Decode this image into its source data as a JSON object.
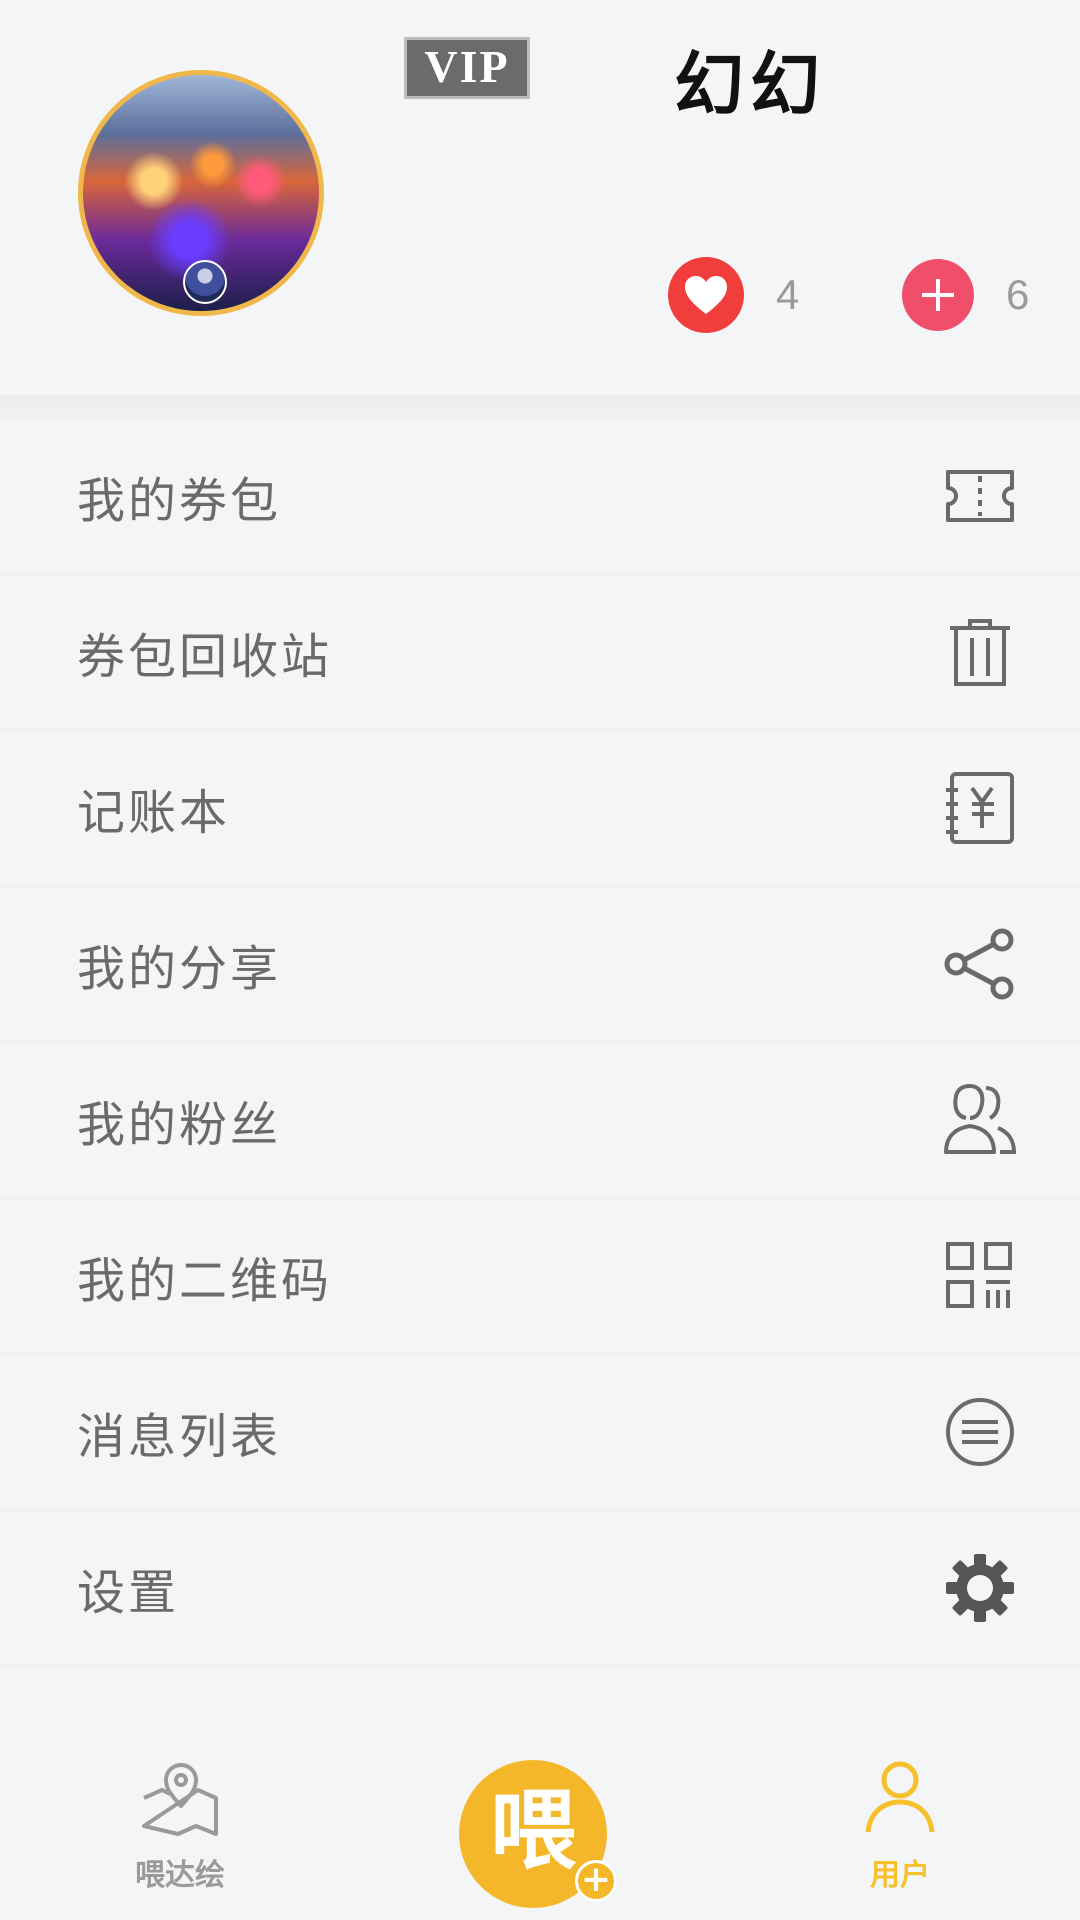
{
  "profile": {
    "vip_label": "VIP",
    "username": "幻幻",
    "likes_count": "4",
    "follows_count": "6",
    "avatar_ring_color": "#f0b84a"
  },
  "menu": {
    "items": [
      {
        "label": "我的券包",
        "icon": "ticket-icon"
      },
      {
        "label": "券包回收站",
        "icon": "trash-icon"
      },
      {
        "label": "记账本",
        "icon": "ledger-yuan-icon"
      },
      {
        "label": "我的分享",
        "icon": "share-icon"
      },
      {
        "label": "我的粉丝",
        "icon": "fans-icon"
      },
      {
        "label": "我的二维码",
        "icon": "qr-code-icon"
      },
      {
        "label": "消息列表",
        "icon": "message-list-icon"
      },
      {
        "label": "设置",
        "icon": "gear-icon"
      }
    ]
  },
  "tabbar": {
    "map_label": "喂达绘",
    "center_glyph": "喂",
    "center_plus": "+",
    "user_label": "用户",
    "active_color": "#f5c12c",
    "inactive_color": "#9a9a9a"
  }
}
